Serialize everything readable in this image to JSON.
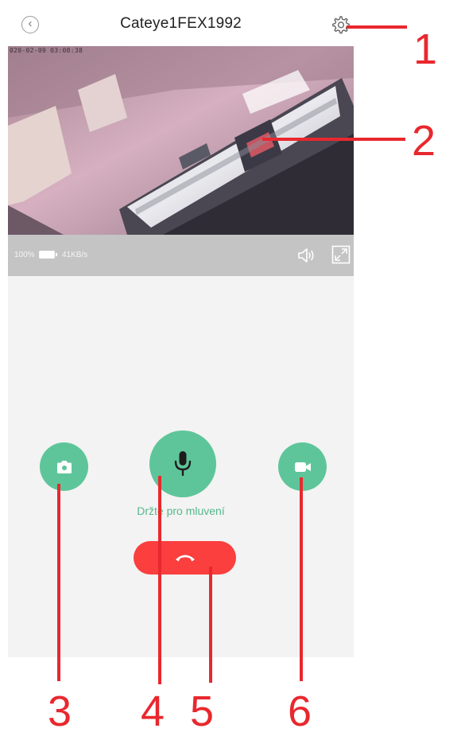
{
  "header": {
    "title": "Cateye1FEX1992",
    "back_icon": "back-arrow-icon",
    "settings_icon": "gear-icon"
  },
  "video": {
    "timestamp": "020-02-09  03:08:38"
  },
  "status_bar": {
    "battery": "100%",
    "speed": "41KB/s",
    "volume_icon": "speaker-icon",
    "fullscreen_icon": "expand-icon"
  },
  "controls": {
    "photo_icon": "camera-icon",
    "mic_icon": "microphone-icon",
    "record_icon": "video-camera-icon",
    "talk_label": "Držte pro mluvení",
    "hangup_icon": "phone-hangup-icon"
  },
  "annotations": [
    "1",
    "2",
    "3",
    "4",
    "5",
    "6"
  ],
  "colors": {
    "accent_green": "#5ec59a",
    "hangup_red": "#fb3e3e",
    "annotation_red": "#e8282e"
  }
}
